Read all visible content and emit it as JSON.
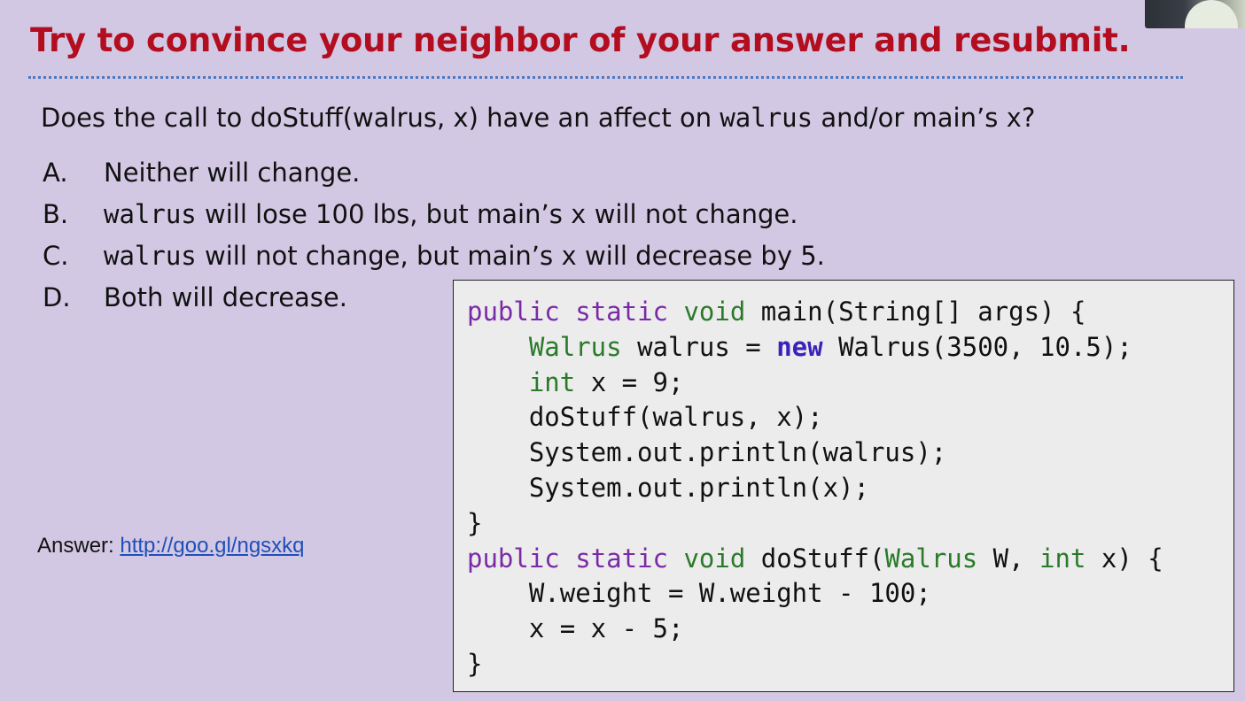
{
  "slide": {
    "title": "Try to convince your neighbor of your answer and resubmit.",
    "question": {
      "part1": "Does the call to doStuff(walrus, x) have an affect on ",
      "code1": "walrus",
      "part2": " and/or main’s ",
      "code2": "x",
      "part3": "?"
    },
    "options": [
      {
        "letter": "A.",
        "code_a": "",
        "text_a": "Neither will change.",
        "code_b": "",
        "text_b": ""
      },
      {
        "letter": "B.",
        "code_a": "walrus",
        "text_a": " will lose 100 lbs, but main’s ",
        "code_b": "x",
        "text_b": " will not change."
      },
      {
        "letter": "C.",
        "code_a": "walrus",
        "text_a": " will not change, but main’s ",
        "code_b": "x",
        "text_b": " will decrease by 5."
      },
      {
        "letter": "D.",
        "code_a": "",
        "text_a": "Both will decrease.",
        "code_b": "",
        "text_b": ""
      }
    ],
    "answer_label": "Answer: ",
    "answer_link": "http://goo.gl/ngsxkq"
  },
  "code": {
    "lines": [
      [
        {
          "t": "public",
          "c": "kw"
        },
        {
          "t": " ",
          "c": ""
        },
        {
          "t": "static",
          "c": "kw"
        },
        {
          "t": " ",
          "c": ""
        },
        {
          "t": "void",
          "c": "ty"
        },
        {
          "t": " main(String[] args) {",
          "c": ""
        }
      ],
      [
        {
          "t": "    ",
          "c": ""
        },
        {
          "t": "Walrus",
          "c": "ty"
        },
        {
          "t": " walrus = ",
          "c": ""
        },
        {
          "t": "new",
          "c": "nw"
        },
        {
          "t": " Walrus(3500, 10.5);",
          "c": ""
        }
      ],
      [
        {
          "t": "    ",
          "c": ""
        },
        {
          "t": "int",
          "c": "ty"
        },
        {
          "t": " x = 9;",
          "c": ""
        }
      ],
      [
        {
          "t": "    doStuff(walrus, x);",
          "c": ""
        }
      ],
      [
        {
          "t": "    System.out.println(walrus);",
          "c": ""
        }
      ],
      [
        {
          "t": "    System.out.println(x);",
          "c": ""
        }
      ],
      [
        {
          "t": "}",
          "c": ""
        }
      ],
      [
        {
          "t": "public",
          "c": "kw"
        },
        {
          "t": " ",
          "c": ""
        },
        {
          "t": "static",
          "c": "kw"
        },
        {
          "t": " ",
          "c": ""
        },
        {
          "t": "void",
          "c": "ty"
        },
        {
          "t": " doStuff(",
          "c": ""
        },
        {
          "t": "Walrus",
          "c": "ty"
        },
        {
          "t": " W, ",
          "c": ""
        },
        {
          "t": "int",
          "c": "ty"
        },
        {
          "t": " x) {",
          "c": ""
        }
      ],
      [
        {
          "t": "    W.weight = W.weight - 100;",
          "c": ""
        }
      ],
      [
        {
          "t": "    x = x - 5;",
          "c": ""
        }
      ],
      [
        {
          "t": "}",
          "c": ""
        }
      ]
    ]
  },
  "colors": {
    "background": "#d3c8e4",
    "title": "#b30e1f",
    "divider": "#4a78c2",
    "keyword": "#7a2aa6",
    "type": "#2a7a2a",
    "new_keyword": "#3a23b8",
    "link": "#1f4fb8",
    "code_background": "#ececec"
  }
}
